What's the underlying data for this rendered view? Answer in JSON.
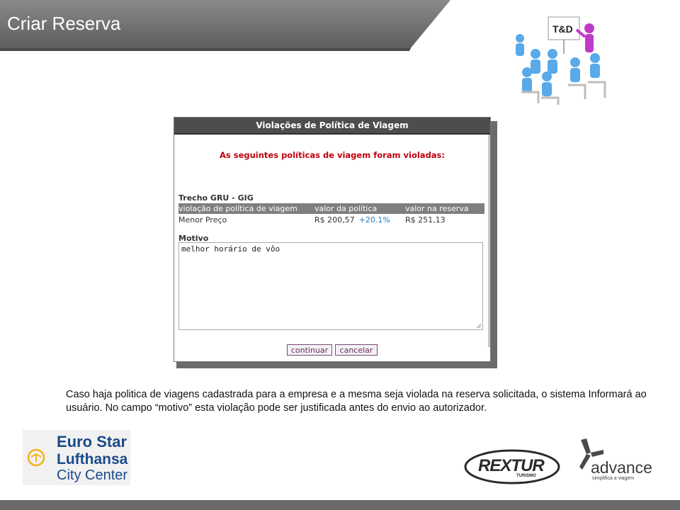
{
  "header": {
    "title": "Criar Reserva"
  },
  "illustration": {
    "board_label": "T&D"
  },
  "dialog": {
    "title": "Violações de Política de Viagem",
    "warning": "As seguintes políticas de viagem foram violadas:",
    "trecho": "Trecho GRU - GIG",
    "table": {
      "headers": [
        "violação de política de viagem",
        "valor da política",
        "valor na reserva"
      ],
      "rows": [
        {
          "policy": "Menor Preço",
          "policy_value": "R$ 200,57",
          "percent": "+20.1%",
          "booking_value": "R$ 251,13"
        }
      ]
    },
    "motivo_label": "Motivo",
    "motivo_value": "melhor horário de vôo",
    "buttons": {
      "continue": "continuar",
      "cancel": "cancelar"
    }
  },
  "caption": "Caso haja politica de viagens cadastrada para a empresa e a mesma seja violada na reserva solicitada, o sistema Informará ao usuário. No campo “motivo” esta violação pode ser justificada antes do envio ao autorizador.",
  "logos": {
    "eurostar": {
      "line1": "Euro Star",
      "line2": "Lufthansa",
      "line3": "City Center"
    },
    "rextur": {
      "word": "REXTUR",
      "sub": "TURISMO"
    },
    "advance": {
      "word": "advance",
      "tagline": "simplifica a viagem"
    }
  },
  "colors": {
    "header_bg": "#6f6f6f",
    "dialog_title_bg": "#4d4d4d",
    "warning_red": "#c0000c",
    "link_blue": "#2a7ab8",
    "brand_blue": "#1a4a8a",
    "lufthansa_yellow": "#f2b21a"
  }
}
